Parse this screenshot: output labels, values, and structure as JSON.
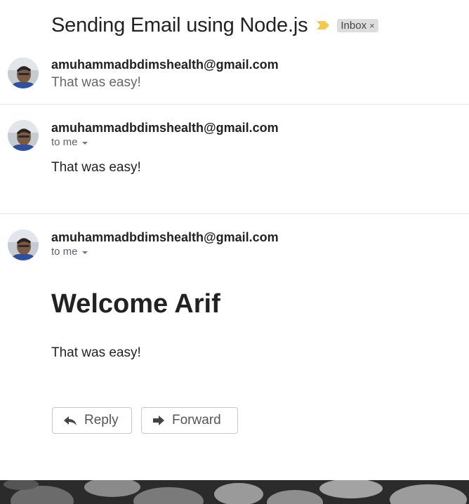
{
  "thread": {
    "subject": "Sending Email using Node.js",
    "label_chip": "Inbox",
    "label_remove": "×",
    "importance_color": "#f2c94c"
  },
  "messages": [
    {
      "sender": "amuhammadbdimshealth@gmail.com",
      "snippet": "That was easy!"
    },
    {
      "sender": "amuhammadbdimshealth@gmail.com",
      "recipient": "to me",
      "body": "That was easy!"
    },
    {
      "sender": "amuhammadbdimshealth@gmail.com",
      "recipient": "to me",
      "heading": "Welcome Arif",
      "body": "That was easy!"
    }
  ],
  "actions": {
    "reply_label": "Reply",
    "forward_label": "Forward"
  },
  "icons": {
    "importance": "importance-marker-icon",
    "reply": "reply-arrow-icon",
    "forward": "forward-arrow-icon",
    "details": "chevron-down-icon"
  }
}
